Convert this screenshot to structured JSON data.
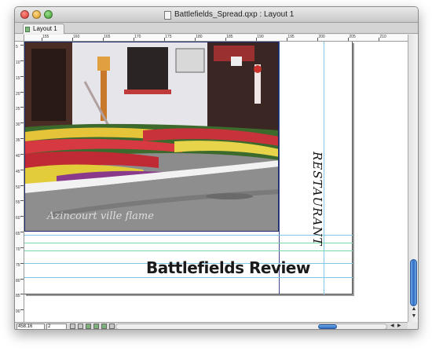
{
  "window": {
    "title": "Battlefields_Spread.qxp : Layout 1",
    "close_icon": "close-icon",
    "minimize_icon": "minimize-icon",
    "zoom_icon": "zoom-icon",
    "document_icon": "document-icon"
  },
  "tabs": [
    {
      "label": "Layout 1",
      "icon": "layout-icon",
      "active": true
    }
  ],
  "rulers": {
    "horizontal_labels": [
      "155",
      "160",
      "165",
      "170",
      "175",
      "180",
      "185",
      "190",
      "195",
      "200",
      "205",
      "210"
    ],
    "vertical_labels": [
      "5",
      "10",
      "15",
      "20",
      "25",
      "30",
      "35",
      "40",
      "45",
      "50",
      "55",
      "60",
      "65",
      "70",
      "75",
      "80",
      "85",
      "90"
    ]
  },
  "page": {
    "photo_caption": "Azincourt ville flame",
    "vertical_title": "RESTAURANT",
    "headline": "Battlefields Review"
  },
  "statusbar": {
    "zoom_value": "458.16",
    "page_value": "2"
  },
  "colors": {
    "guide_blue": "#7fc7e6",
    "guide_green": "#78d8a8",
    "frame_navy": "#1a2a6a",
    "scroll_accent": "#2f6cc4"
  }
}
